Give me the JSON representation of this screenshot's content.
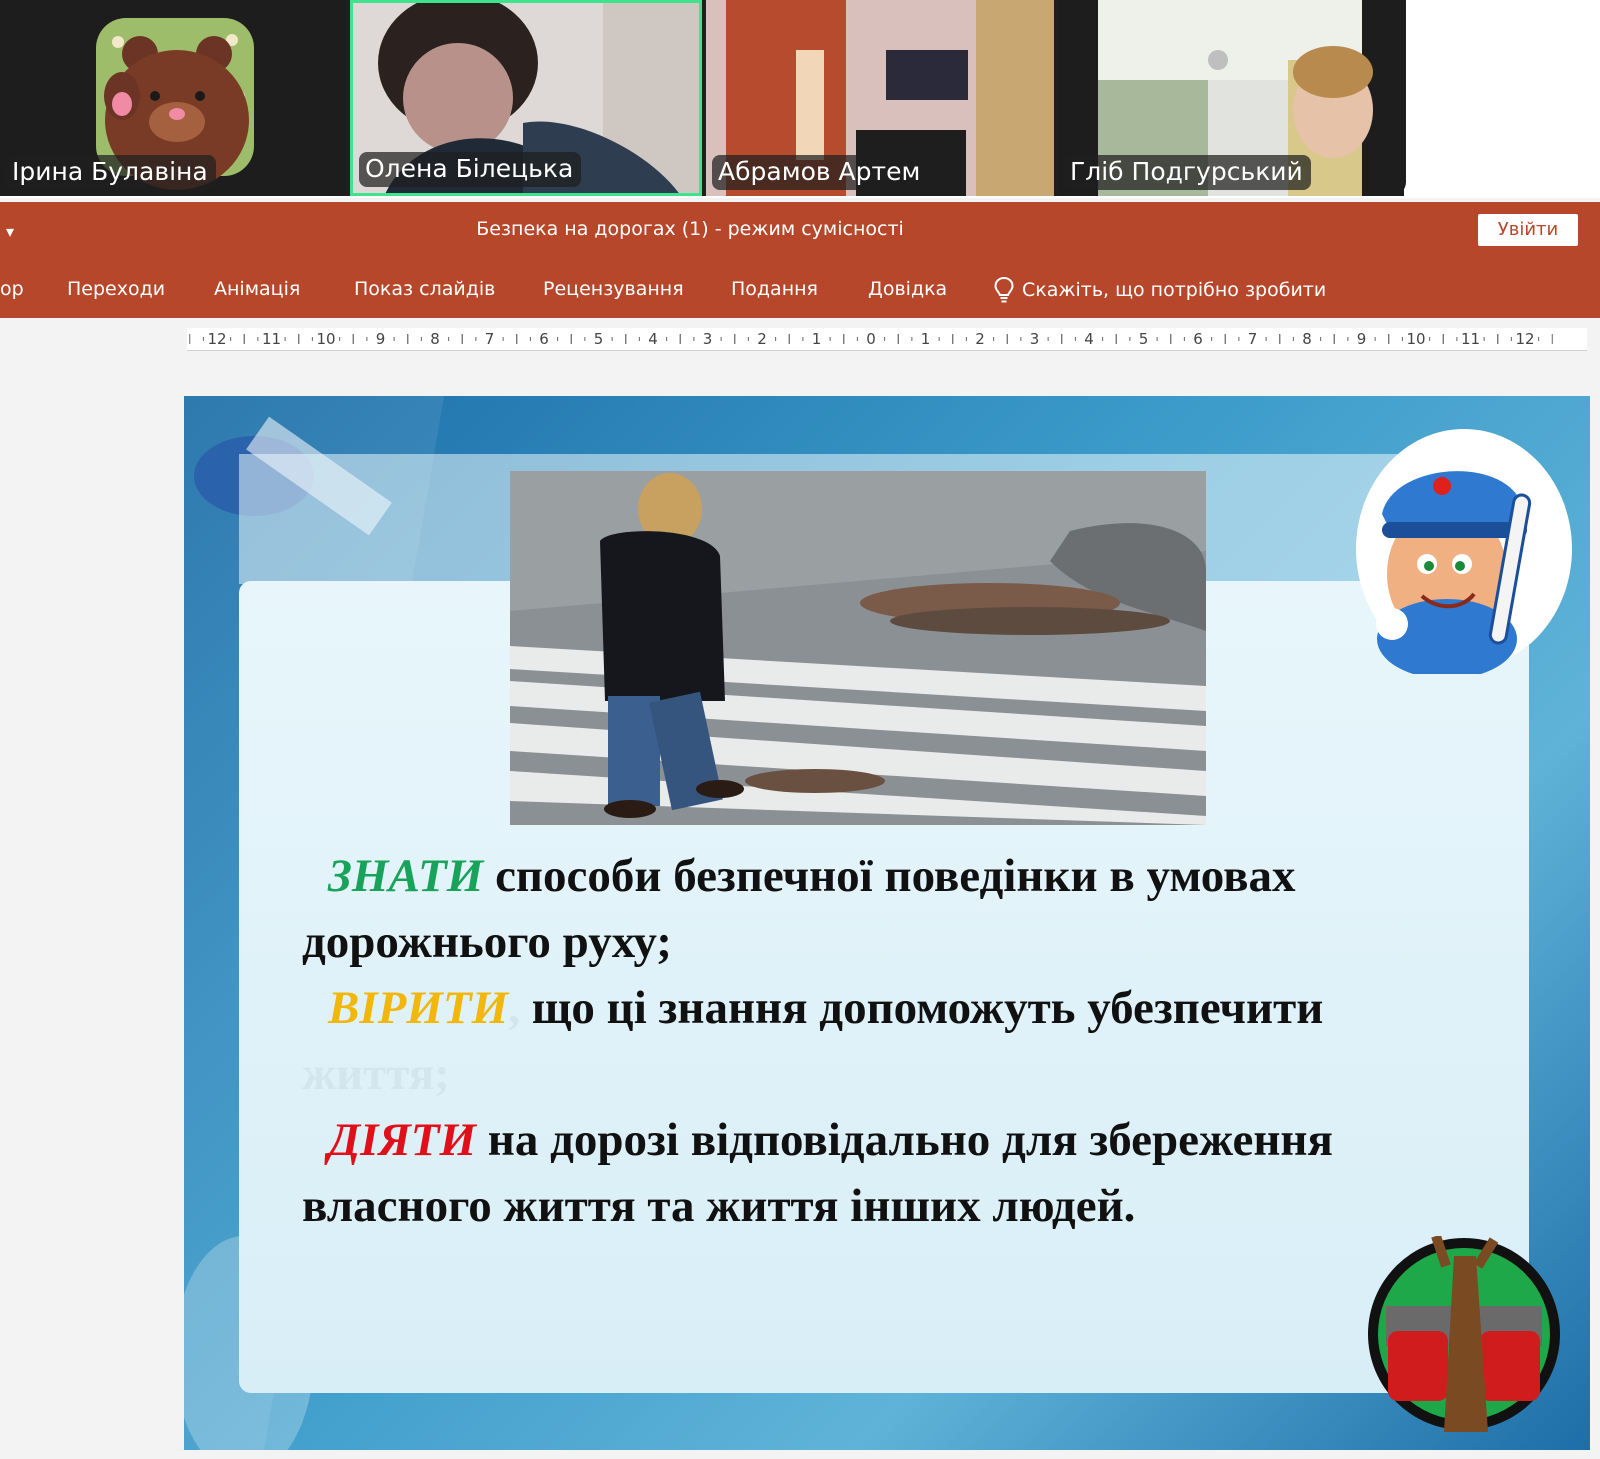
{
  "participants": [
    {
      "name": "Ірина Булавіна"
    },
    {
      "name": "Олена Білецька"
    },
    {
      "name": "Абрамов Артем"
    },
    {
      "name": "Гліб Подгурський"
    }
  ],
  "titlebar": {
    "document_title": "Безпека на дорогах (1)  -  режим сумісності",
    "signin_label": "Увійти"
  },
  "ribbon": {
    "tabs": [
      "ор",
      "Переходи",
      "Анімація",
      "Показ слайдів",
      "Рецензування",
      "Подання",
      "Довідка"
    ],
    "tell_me": "Скажіть, що потрібно зробити"
  },
  "ruler": {
    "labels": [
      "12",
      "11",
      "10",
      "9",
      "8",
      "7",
      "6",
      "5",
      "4",
      "3",
      "2",
      "1",
      "0",
      "1",
      "2",
      "3",
      "4",
      "5",
      "6",
      "7",
      "8",
      "9",
      "10",
      "11",
      "12"
    ]
  },
  "slide": {
    "p1_kw": "ЗНАТИ",
    "p1_rest": "способи безпечної поведінки в умовах дорожнього руху;",
    "p2_kw": "ВІРИТИ",
    "p2_comma": ",",
    "p2_rest": "що ці знання допоможуть убезпечити",
    "p2_faded": "життя;",
    "p3_kw": "ДІЯТИ",
    "p3_rest": "на дорозі відповідально  для збереження власного життя та життя інших людей."
  },
  "colors": {
    "ribbon": "#b7472a",
    "active_speaker": "#3fe38c",
    "kw_green": "#19a35a",
    "kw_yellow": "#f2b70a",
    "kw_red": "#e0101a"
  }
}
